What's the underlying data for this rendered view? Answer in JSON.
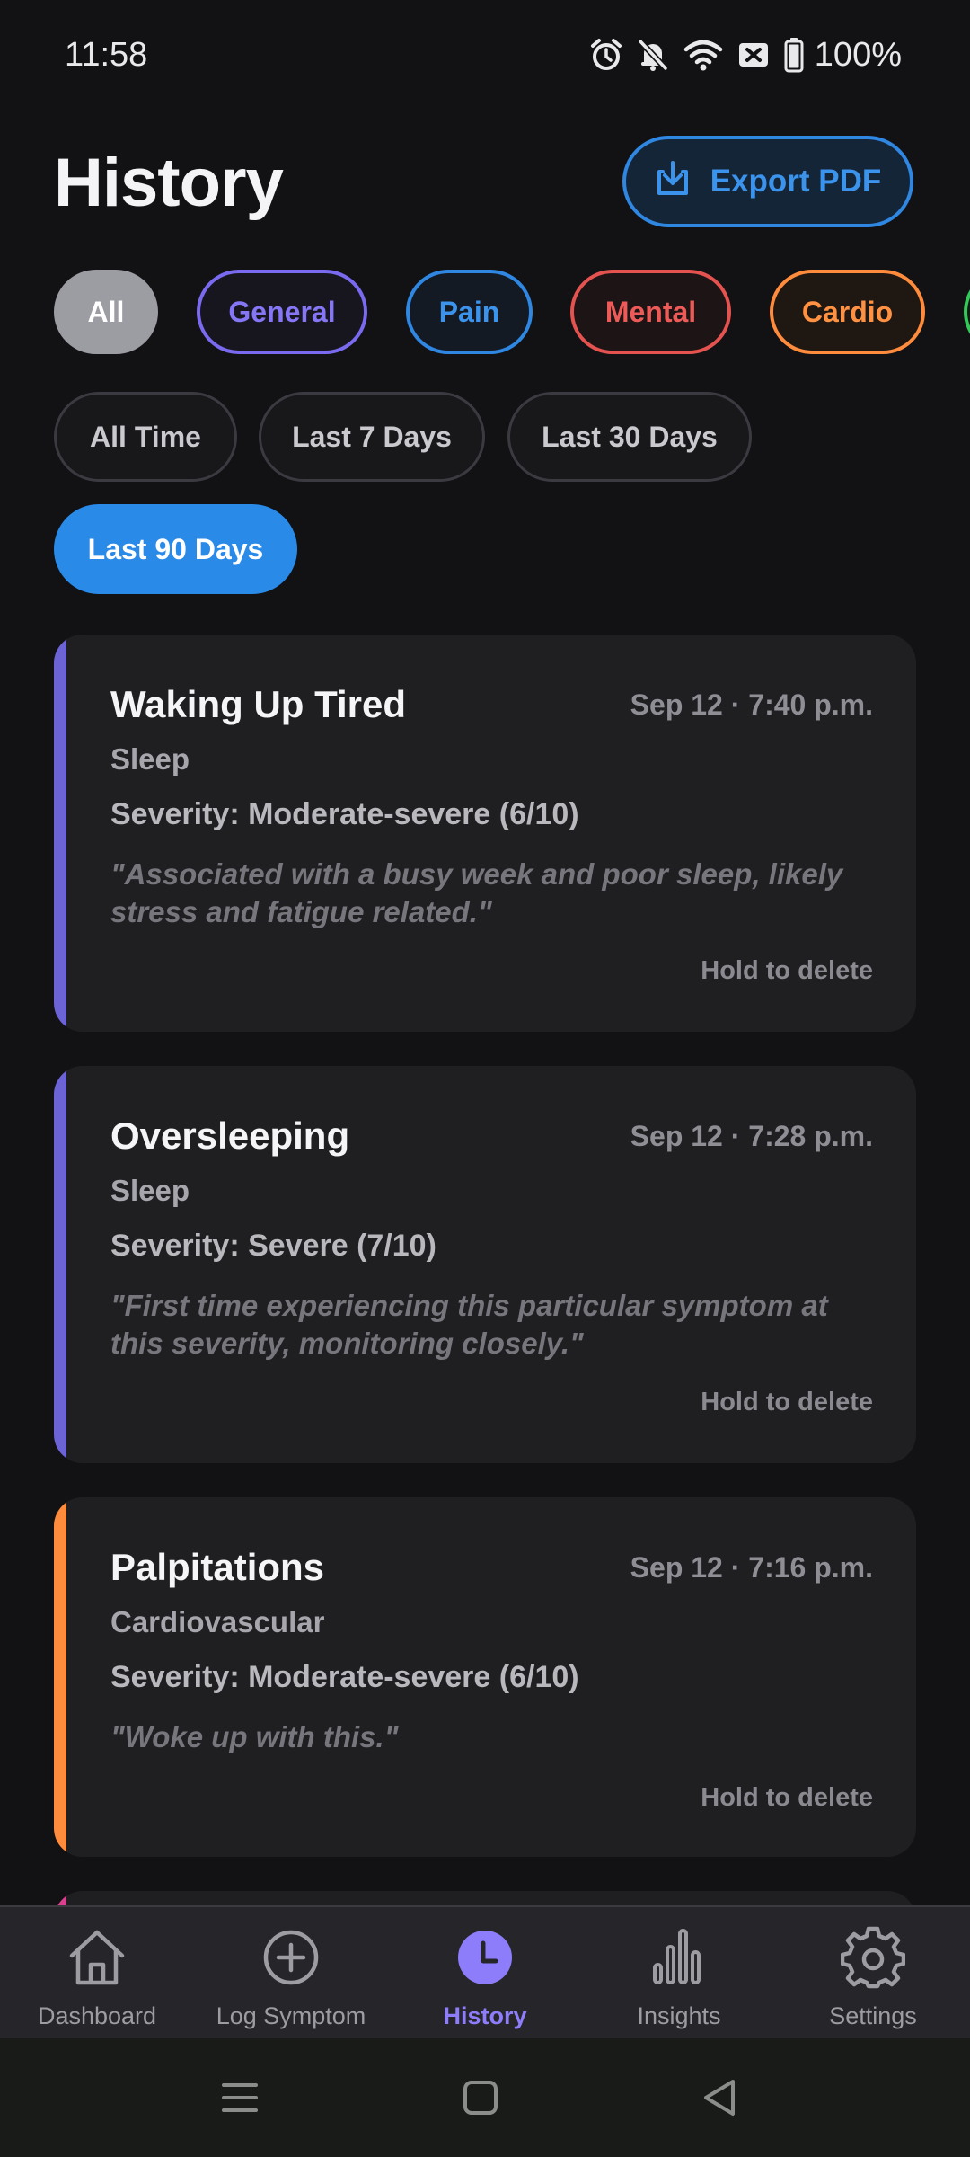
{
  "status_bar": {
    "time": "11:58",
    "battery": "100%",
    "icons": [
      "alarm-icon",
      "mute-icon",
      "wifi-icon",
      "no-sim-icon",
      "battery-icon"
    ]
  },
  "header": {
    "title": "History",
    "export_label": "Export PDF"
  },
  "categories": {
    "all": "All",
    "general": "General",
    "pain": "Pain",
    "mental": "Mental",
    "cardio": "Cardio"
  },
  "time_filters": {
    "all_time": "All Time",
    "last_7": "Last 7 Days",
    "last_30": "Last 30 Days",
    "last_90": "Last 90 Days",
    "selected": "Last 90 Days"
  },
  "entries": [
    {
      "title": "Waking Up Tired",
      "date": "Sep 12 · 7:40 p.m.",
      "category": "Sleep",
      "severity": "Severity: Moderate-severe (6/10)",
      "note": "\"Associated with a busy week and poor sleep, likely stress and fatigue related.\"",
      "hold": "Hold to delete",
      "color": "#6b63d6"
    },
    {
      "title": "Oversleeping",
      "date": "Sep 12 · 7:28 p.m.",
      "category": "Sleep",
      "severity": "Severity: Severe (7/10)",
      "note": "\"First time experiencing this particular symptom at this severity, monitoring closely.\"",
      "hold": "Hold to delete",
      "color": "#6b63d6"
    },
    {
      "title": "Palpitations",
      "date": "Sep 12 · 7:16 p.m.",
      "category": "Cardiovascular",
      "severity": "Severity: Moderate-severe (6/10)",
      "note": "\"Woke up with this.\"",
      "hold": "Hold to delete",
      "color": "#ff8b3d"
    }
  ],
  "partial_card_color": "#d9408e",
  "nav": {
    "dashboard": "Dashboard",
    "log": "Log Symptom",
    "history": "History",
    "insights": "Insights",
    "settings": "Settings",
    "active": "History",
    "active_color": "#8d7dfa"
  }
}
